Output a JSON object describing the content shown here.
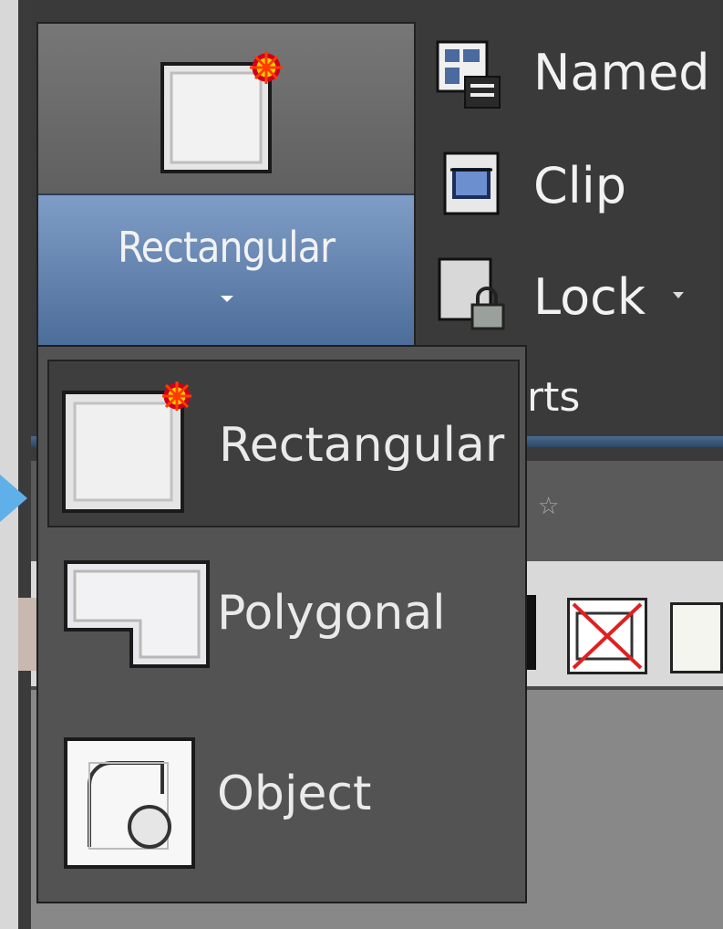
{
  "ribbon": {
    "main_button": {
      "label": "Rectangular",
      "has_dropdown": true,
      "icon": "rectangular-clip-icon"
    },
    "commands": [
      {
        "label": "Named",
        "icon": "named-views-icon"
      },
      {
        "label": "Clip",
        "icon": "clip-icon"
      },
      {
        "label": "Lock",
        "icon": "lock-icon",
        "has_dropdown": true
      }
    ],
    "panel_title_fragment": "rts",
    "quick_access_fragment": "☆"
  },
  "dropdown": {
    "items": [
      {
        "label": "Rectangular",
        "icon": "rectangular-viewport-icon",
        "selected": true
      },
      {
        "label": "Polygonal",
        "icon": "polygonal-viewport-icon",
        "selected": false
      },
      {
        "label": "Object",
        "icon": "object-viewport-icon",
        "selected": false
      }
    ]
  },
  "colors": {
    "accent_blue": "#5b7eaf",
    "pointer_arrow": "#5fb0e8",
    "x_mark": "#e02020"
  }
}
